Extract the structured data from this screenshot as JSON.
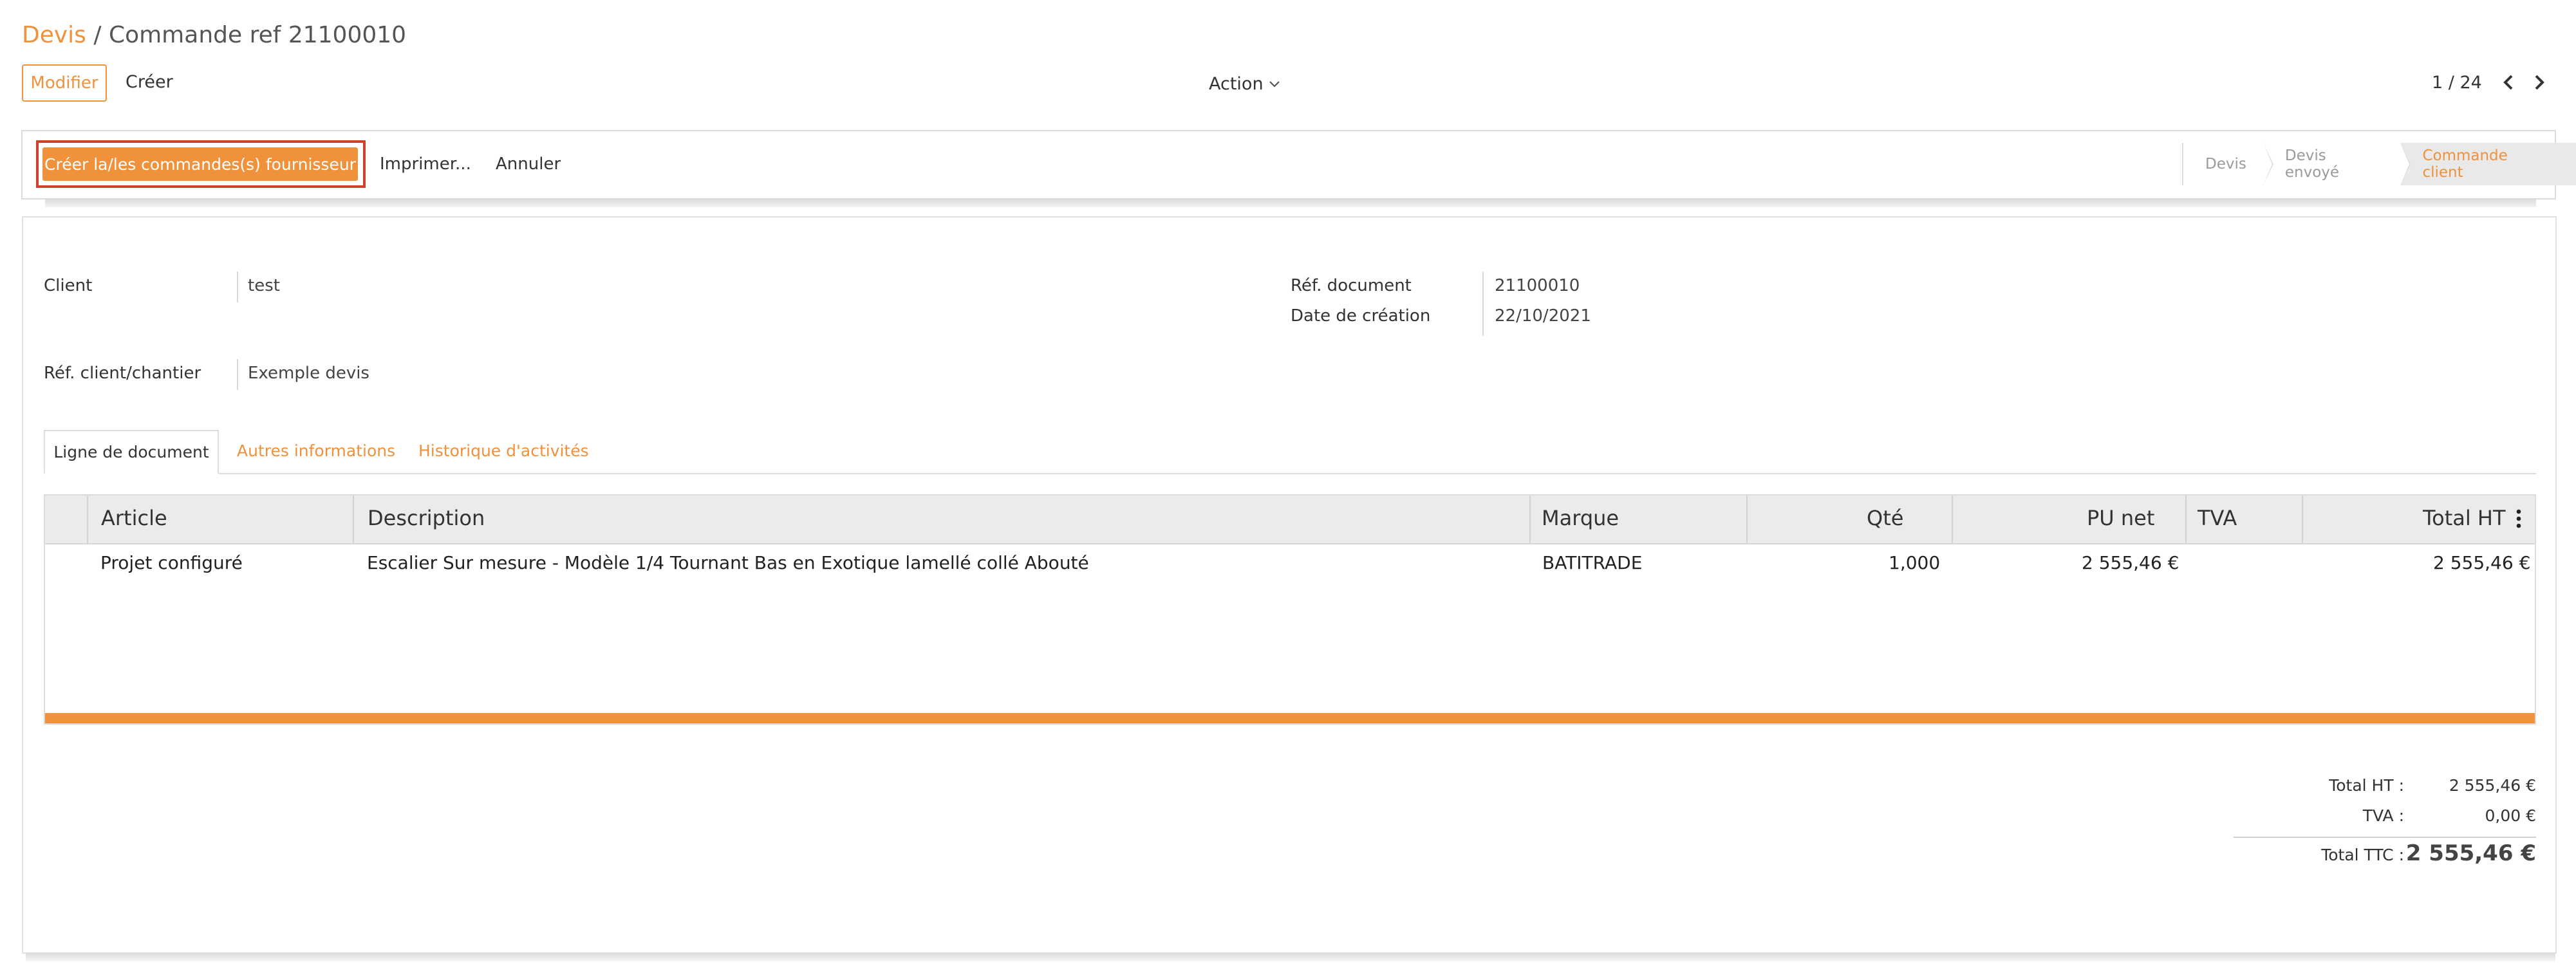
{
  "breadcrumb": {
    "root": "Devis",
    "separator": " / ",
    "current": "Commande ref 21100010"
  },
  "controls": {
    "modifier": "Modifier",
    "creer": "Créer",
    "action": "Action",
    "pager": "1 / 24"
  },
  "statusbar": {
    "create_supplier": "Créer la/les commandes(s) fournisseur",
    "imprimer": "Imprimer...",
    "annuler": "Annuler",
    "stages": [
      "Devis",
      "Devis envoyé",
      "Commande client"
    ],
    "active_stage": "Commande client"
  },
  "form": {
    "client_label": "Client",
    "client_value": "test",
    "ref_client_label": "Réf. client/chantier",
    "ref_client_value": "Exemple devis",
    "ref_doc_label": "Réf. document",
    "ref_doc_value": "21100010",
    "date_label": "Date de création",
    "date_value": "22/10/2021"
  },
  "tabs": [
    "Ligne de document",
    "Autres informations",
    "Historique d'activités"
  ],
  "table": {
    "headers": [
      "Article",
      "Description",
      "Marque",
      "Qté",
      "PU net",
      "TVA",
      "Total HT"
    ],
    "rows": [
      {
        "article": "Projet configuré",
        "description": "Escalier Sur mesure - Modèle 1/4 Tournant Bas en Exotique lamellé collé Abouté",
        "marque": "BATITRADE",
        "qte": "1,000",
        "pu_net": "2 555,46 €",
        "tva": "",
        "total_ht": "2 555,46 €"
      }
    ]
  },
  "totals": {
    "ht_label": "Total HT :",
    "ht_value": "2 555,46 €",
    "tva_label": "TVA :",
    "tva_value": "0,00 €",
    "ttc_label": "Total TTC :",
    "ttc_value": "2 555,46 €"
  },
  "colors": {
    "accent": "#f0913c",
    "highlight": "#d0402f"
  },
  "icons": {
    "action_chevron": "chevron-down-icon",
    "pager_prev": "chevron-left-icon",
    "pager_next": "chevron-right-icon",
    "column_menu": "kebab-menu-icon"
  }
}
